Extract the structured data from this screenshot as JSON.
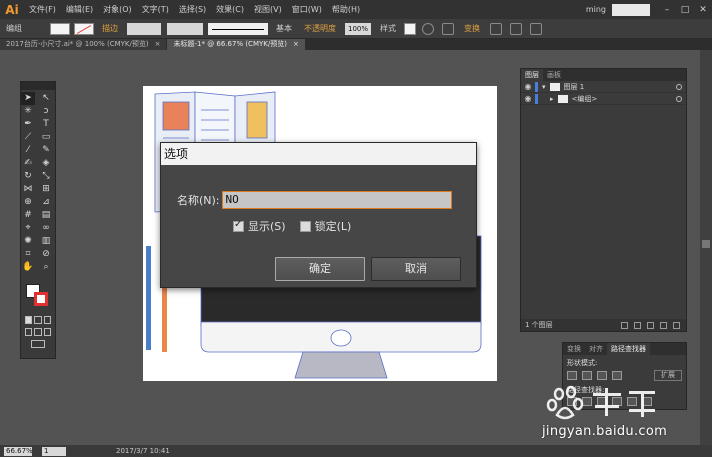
{
  "app": {
    "logo": "Ai"
  },
  "menu": [
    "文件(F)",
    "编辑(E)",
    "对象(O)",
    "文字(T)",
    "选择(S)",
    "效果(C)",
    "视图(V)",
    "窗口(W)",
    "帮助(H)"
  ],
  "user": "ming",
  "window_controls": [
    "–",
    "□",
    "✕"
  ],
  "control_bar": {
    "label": "编组",
    "stroke_label": "描边",
    "stroke_style": "基本",
    "opacity_label": "不透明度",
    "opacity_value": "100%",
    "style_label": "样式",
    "transform_label": "变换"
  },
  "tabs": [
    {
      "label": "2017台历-小尺寸.ai* @ 100% (CMYK/预览)",
      "close": "×"
    },
    {
      "label": "未标题-1* @ 66.67% (CMYK/预览)",
      "close": "×"
    }
  ],
  "dialog": {
    "title": "选项",
    "name_label": "名称(N):",
    "name_value": "NO",
    "show_label": "显示(S)",
    "show_checked": true,
    "lock_label": "锁定(L)",
    "lock_checked": false,
    "ok_label": "确定",
    "cancel_label": "取消"
  },
  "layers_panel": {
    "tabs": [
      "图层",
      "画板"
    ],
    "rows": [
      {
        "name": "图层 1"
      },
      {
        "name": "<编组>"
      }
    ],
    "footer_count": "1 个图层"
  },
  "pathfinder_panel": {
    "tabs": [
      "变换",
      "对齐",
      "路径查找器"
    ],
    "shape_modes_label": "形状模式:",
    "expand_label": "扩展",
    "pathfinder_label": "路径查找器:"
  },
  "status": {
    "zoom": "66.67%",
    "page": "1",
    "datetime": "2017/3/7  10:41"
  },
  "watermark": {
    "text": "jingyan.baidu.com"
  },
  "colors": {
    "accent": "#f29a2e",
    "focus_border": "#e07a20",
    "stroke_red": "#e03030",
    "layer_blue": "#4a7fd8"
  }
}
